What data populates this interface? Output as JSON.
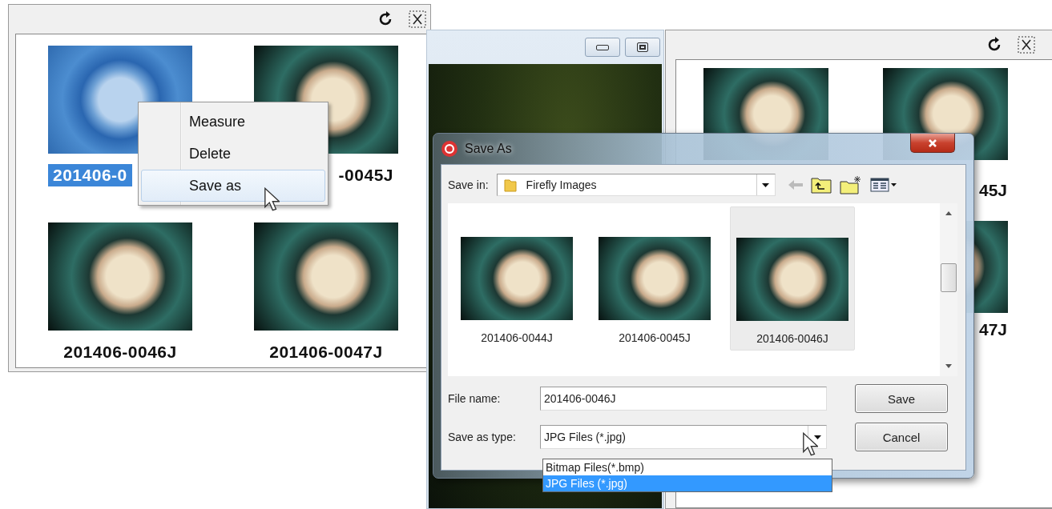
{
  "viewer_left": {
    "thumbnails": [
      {
        "label": "201406-0",
        "selected": true
      },
      {
        "label": "-0045J",
        "selected": false
      },
      {
        "label": "201406-0046J",
        "selected": false
      },
      {
        "label": "201406-0047J",
        "selected": false
      }
    ]
  },
  "context_menu": {
    "items": [
      {
        "label": "Measure",
        "highlighted": false
      },
      {
        "label": "Delete",
        "highlighted": false
      },
      {
        "label": "Save as",
        "highlighted": true
      }
    ]
  },
  "viewer_right": {
    "labels": [
      "45J",
      "47J"
    ]
  },
  "dialog": {
    "title": "Save As",
    "save_in": {
      "label": "Save in:",
      "value": "Firefly Images"
    },
    "files": [
      {
        "name": "201406-0044J",
        "selected": false
      },
      {
        "name": "201406-0045J",
        "selected": false
      },
      {
        "name": "201406-0046J",
        "selected": true
      }
    ],
    "file_name": {
      "label": "File name:",
      "value": "201406-0046J"
    },
    "save_type": {
      "label": "Save as type:",
      "value": "JPG Files (*.jpg)",
      "options": [
        {
          "label": "Bitmap Files(*.bmp)",
          "selected": false
        },
        {
          "label": "JPG Files (*.jpg)",
          "selected": true
        }
      ]
    },
    "buttons": [
      "Save",
      "Cancel"
    ]
  }
}
